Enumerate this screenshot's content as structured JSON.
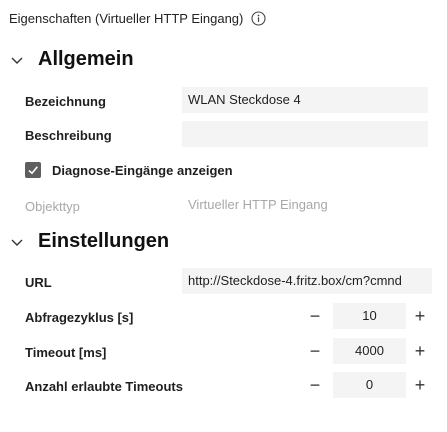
{
  "panel": {
    "title": "Eigenschaften (Virtueller HTTP Eingang)"
  },
  "general": {
    "heading": "Allgemein",
    "name_label": "Bezeichnung",
    "name_value": "WLAN Steckdose 4",
    "description_label": "Beschreibung",
    "description_value": "",
    "diagnose_label": "Diagnose-Eingänge anzeigen",
    "diagnose_checked": true,
    "object_type_label": "Objekttyp",
    "object_type_value": "Virtueller HTTP Eingang"
  },
  "settings": {
    "heading": "Einstellungen",
    "url_label": "URL",
    "url_value": "http://Steckdose-4.fritz.box/cm?cmnd",
    "poll_label": "Abfragezyklus [s]",
    "poll_value": "10",
    "timeout_label": "Timeout [ms]",
    "timeout_value": "4000",
    "allowed_timeouts_label": "Anzahl erlaubte Timeouts",
    "allowed_timeouts_value": "0",
    "minus": "−",
    "plus": "+"
  }
}
